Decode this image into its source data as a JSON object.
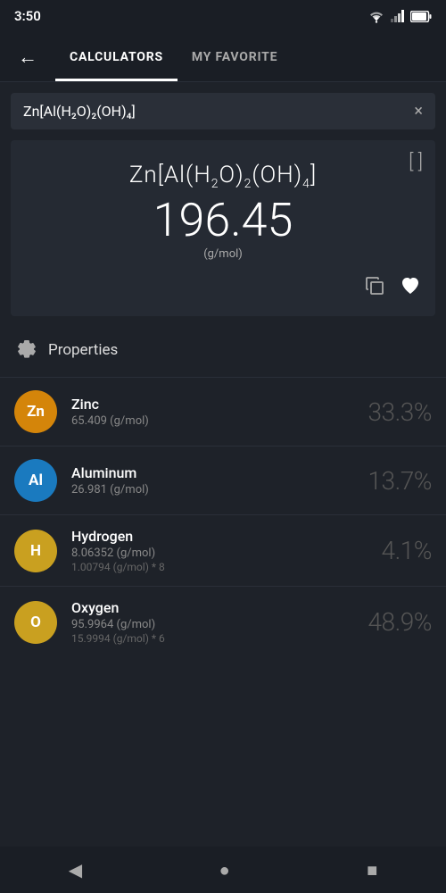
{
  "statusBar": {
    "time": "3:50"
  },
  "nav": {
    "backLabel": "←",
    "tab1": "CALCULATORS",
    "tab2": "MY FAVORITE"
  },
  "searchBar": {
    "value": "Zn[Al(H₂O)₂(OH)₄]",
    "clearIcon": "×"
  },
  "formulaCard": {
    "bracketIcon": "[ ]",
    "formula": "Zn[Al(H₂O)₂(OH)₄]",
    "mass": "196.45",
    "unit": "(g/mol)",
    "copyIcon": "⧉",
    "heartIcon": "♥"
  },
  "properties": {
    "gearIcon": "⚙",
    "label": "Properties"
  },
  "elements": [
    {
      "symbol": "Zn",
      "badgeClass": "badge-zn",
      "name": "Zinc",
      "mol": "65.409 (g/mol)",
      "detail": "",
      "percent": "33.3%"
    },
    {
      "symbol": "Al",
      "badgeClass": "badge-al",
      "name": "Aluminum",
      "mol": "26.981 (g/mol)",
      "detail": "",
      "percent": "13.7%"
    },
    {
      "symbol": "H",
      "badgeClass": "badge-h",
      "name": "Hydrogen",
      "mol": "8.06352 (g/mol)",
      "detail": "1.00794 (g/mol) * 8",
      "percent": "4.1%"
    },
    {
      "symbol": "O",
      "badgeClass": "badge-o",
      "name": "Oxygen",
      "mol": "95.9964 (g/mol)",
      "detail": "15.9994 (g/mol) * 6",
      "percent": "48.9%"
    }
  ],
  "bottomNav": {
    "back": "◀",
    "home": "●",
    "recent": "■"
  }
}
